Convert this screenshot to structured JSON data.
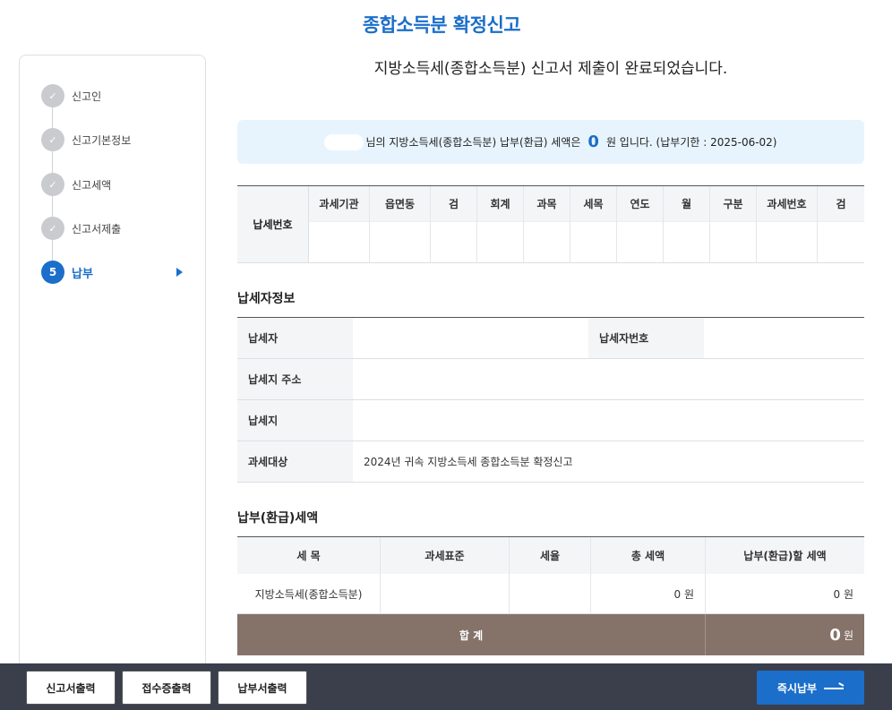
{
  "page_title": "종합소득분 확정신고",
  "steps": [
    {
      "label": "신고인",
      "status": "done"
    },
    {
      "label": "신고기본정보",
      "status": "done"
    },
    {
      "label": "신고세액",
      "status": "done"
    },
    {
      "label": "신고서제출",
      "status": "done"
    },
    {
      "label": "납부",
      "number": "5",
      "status": "active"
    }
  ],
  "complete_message": "지방소득세(종합소득분) 신고서 제출이 완료되었습니다.",
  "notice": {
    "text_before": "님의 지방소득세(종합소득분) 납부(환급) 세액은",
    "amount": "0",
    "text_after": "원 입니다. (납부기한 : 2025-06-02)"
  },
  "tax_number": {
    "header": "납세번호",
    "columns": [
      "과세기관",
      "읍면동",
      "검",
      "회계",
      "과목",
      "세목",
      "연도",
      "월",
      "구분",
      "과세번호",
      "검"
    ]
  },
  "taxpayer_section": {
    "title": "납세자정보",
    "rows": [
      {
        "label": "납세자",
        "value": "",
        "label2": "납세자번호",
        "value2": ""
      },
      {
        "label": "납세지 주소",
        "value": ""
      },
      {
        "label": "납세지",
        "value": ""
      },
      {
        "label": "과세대상",
        "value": "2024년 귀속 지방소득세 종합소득분 확정신고"
      }
    ]
  },
  "payment_section": {
    "title": "납부(환급)세액",
    "headers": [
      "세 목",
      "과세표준",
      "세율",
      "총 세액",
      "납부(환급)할 세액"
    ],
    "row": [
      "지방소득세(종합소득분)",
      "",
      "",
      "0 원",
      "0 원"
    ],
    "total_label": "합 계",
    "total_amount": "0",
    "total_unit": "원"
  },
  "footer": {
    "print_report": "신고서출력",
    "print_receipt": "접수증출력",
    "print_payment": "납부서출력",
    "pay_now": "즉시납부"
  },
  "colors": {
    "accent": "#1b6ec9",
    "total_bg": "#857269",
    "footer_bg": "#3b3e4b",
    "notice_bg": "#e8f4fd"
  }
}
